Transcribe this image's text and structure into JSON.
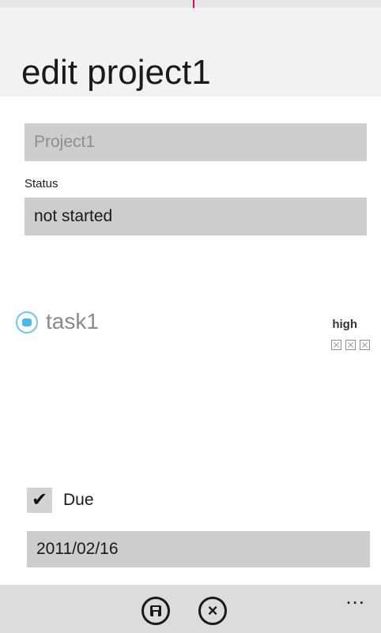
{
  "header": {
    "title": "edit project1"
  },
  "form": {
    "name_value": "Project1",
    "status_label": "Status",
    "status_value": "not started"
  },
  "tasks": [
    {
      "title": "task1",
      "priority": "high",
      "icon": "mail-circle-icon"
    }
  ],
  "due": {
    "label": "Due",
    "checked": true,
    "date_value": "2011/02/16"
  },
  "app_bar": {
    "buttons": [
      {
        "name": "save",
        "icon": "save-icon"
      },
      {
        "name": "cancel",
        "icon": "close-icon"
      }
    ],
    "more": "..."
  },
  "colors": {
    "accent": "#e0007a",
    "task_icon": "#4db8ec",
    "field_bg": "#cdcdcd",
    "app_bar_bg": "#dcdcdc"
  }
}
